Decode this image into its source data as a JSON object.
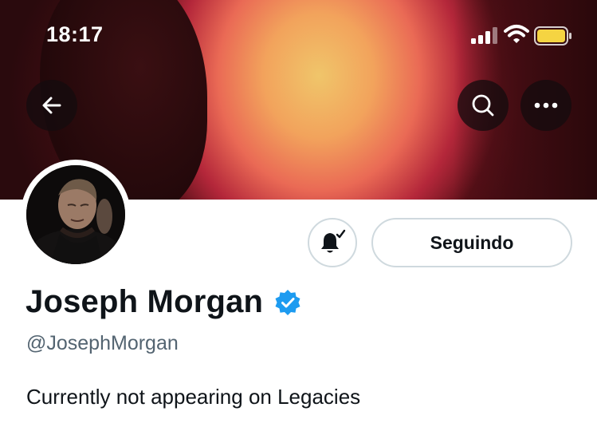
{
  "status_bar": {
    "time": "18:17",
    "icons": [
      "signal-icon",
      "wifi-icon",
      "battery-icon"
    ]
  },
  "header": {
    "back_icon": "arrow-left-icon",
    "search_icon": "search-icon",
    "more_icon": "more-horizontal-icon"
  },
  "profile": {
    "display_name": "Joseph Morgan",
    "handle": "@JosephMorgan",
    "bio": "Currently not appearing on Legacies",
    "verified_icon": "verified-badge-icon",
    "follow_button_label": "Seguindo",
    "notifications_icon": "bell-check-icon"
  },
  "colors": {
    "verified_blue": "#1d9bf0",
    "text_primary": "#0f1419",
    "text_secondary": "#536471",
    "button_border": "#cfd9de",
    "battery_yellow": "#f5d442"
  }
}
